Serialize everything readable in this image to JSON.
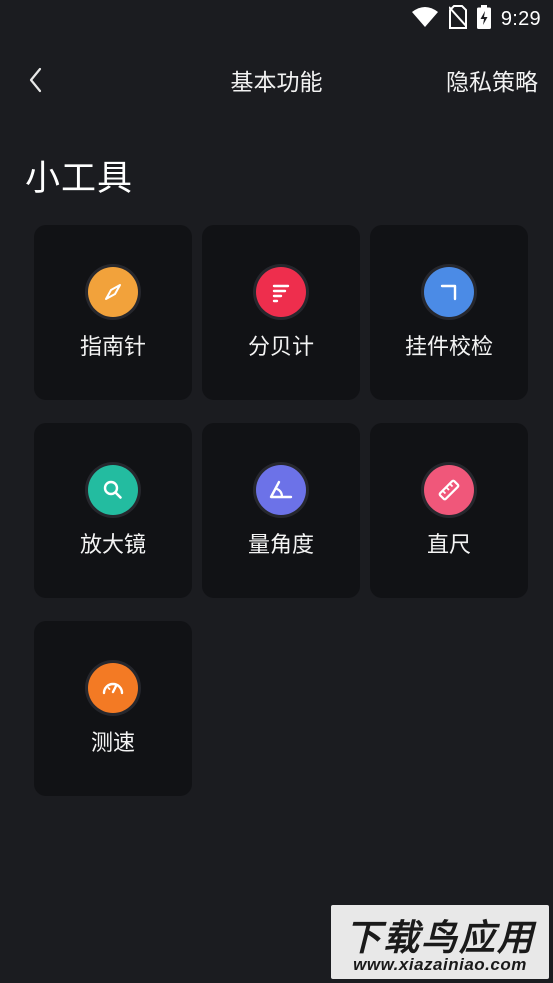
{
  "status_bar": {
    "time": "9:29",
    "icons": [
      "wifi-icon",
      "no-sim-icon",
      "battery-charging-icon"
    ]
  },
  "header": {
    "title": "基本功能",
    "privacy_label": "隐私策略",
    "back_icon": "chevron-left-icon"
  },
  "section": {
    "title": "小工具"
  },
  "tools": [
    {
      "label": "指南针",
      "icon": "compass-icon",
      "color": "#f2a23b"
    },
    {
      "label": "分贝计",
      "icon": "decibel-icon",
      "color": "#ee2e4d"
    },
    {
      "label": "挂件校检",
      "icon": "level-check-icon",
      "color": "#4b8be6"
    },
    {
      "label": "放大镜",
      "icon": "magnifier-icon",
      "color": "#23bca0"
    },
    {
      "label": "量角度",
      "icon": "protractor-icon",
      "color": "#6c72e8"
    },
    {
      "label": "直尺",
      "icon": "ruler-icon",
      "color": "#f0577a"
    },
    {
      "label": "测速",
      "icon": "speedometer-icon",
      "color": "#f37a24"
    }
  ],
  "watermark": {
    "brand": "下载鸟应用",
    "url": "www.xiazainiao.com"
  }
}
